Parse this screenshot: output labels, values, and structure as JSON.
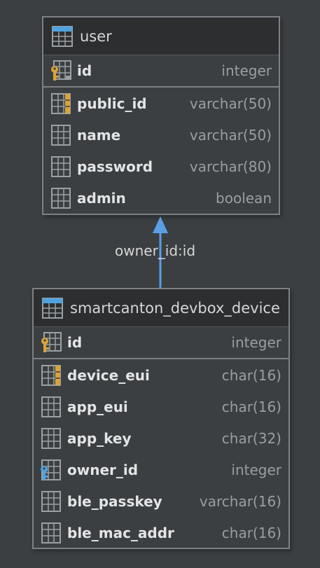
{
  "user_table": {
    "title": "user",
    "pk": {
      "name": "id",
      "type": "integer"
    },
    "columns": [
      {
        "name": "public_id",
        "type": "varchar(50)",
        "icon": "unique-column-icon"
      },
      {
        "name": "name",
        "type": "varchar(50)",
        "icon": "column-icon"
      },
      {
        "name": "password",
        "type": "varchar(80)",
        "icon": "column-icon"
      },
      {
        "name": "admin",
        "type": "boolean",
        "icon": "column-icon"
      }
    ]
  },
  "device_table": {
    "title": "smartcanton_devbox_device",
    "pk": {
      "name": "id",
      "type": "integer"
    },
    "columns": [
      {
        "name": "device_eui",
        "type": "char(16)",
        "icon": "unique-column-icon"
      },
      {
        "name": "app_eui",
        "type": "char(16)",
        "icon": "column-icon"
      },
      {
        "name": "app_key",
        "type": "char(32)",
        "icon": "column-icon"
      },
      {
        "name": "owner_id",
        "type": "integer",
        "icon": "foreign-key-icon"
      },
      {
        "name": "ble_passkey",
        "type": "varchar(16)",
        "icon": "column-icon"
      },
      {
        "name": "ble_mac_addr",
        "type": "char(16)",
        "icon": "column-icon"
      }
    ]
  },
  "relation": {
    "label": "owner_id:id"
  },
  "colors": {
    "background": "#3c3f41",
    "header": "#2c2e30",
    "border": "#7d8185",
    "arrow": "#5a9fe6",
    "key_gold": "#d9a43a",
    "key_blue": "#4fa3e0"
  }
}
